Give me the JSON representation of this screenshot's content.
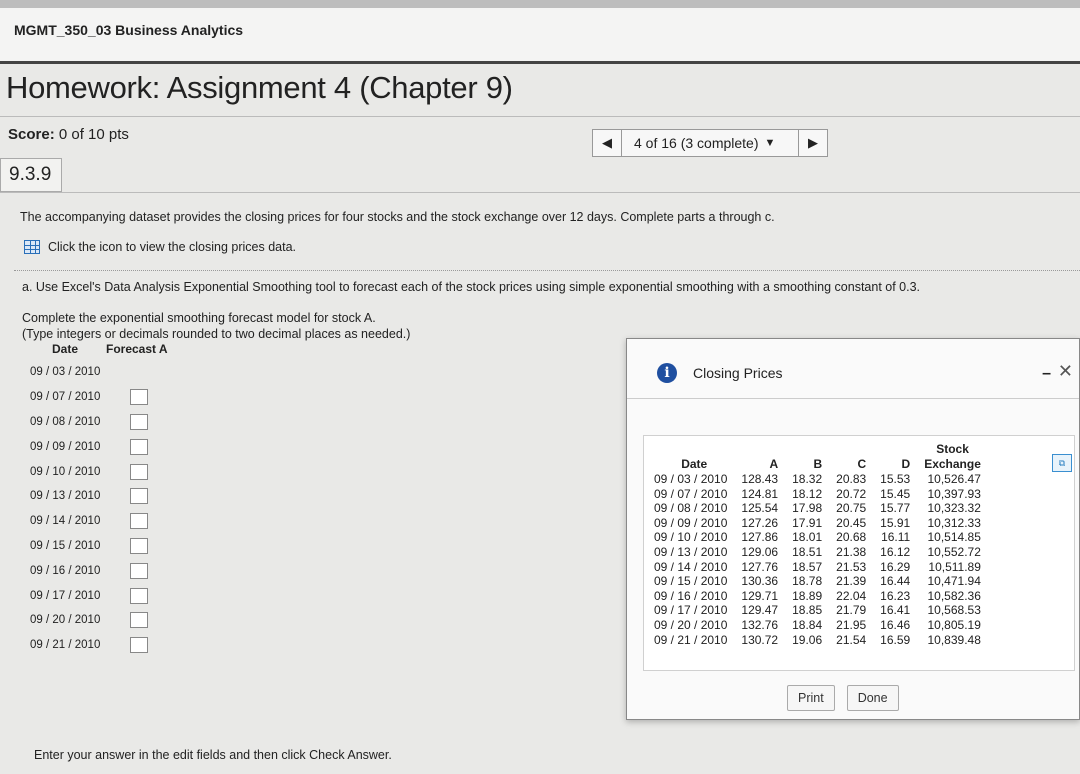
{
  "course": {
    "title": "MGMT_350_03 Business Analytics"
  },
  "assignment": {
    "title": "Homework: Assignment 4 (Chapter 9)"
  },
  "score": {
    "label": "Score:",
    "value": "0 of 10 pts"
  },
  "nav": {
    "prev_icon": "◀",
    "position": "4 of 16 (3 complete)",
    "dropdown_icon": "▼",
    "next_icon": "▶"
  },
  "question": {
    "number": "9.3.9",
    "intro": "The accompanying dataset provides the closing prices for four stocks and the stock exchange over 12 days. Complete parts a through c.",
    "data_link": "Click the icon to view the closing prices data.",
    "part_a": "a. Use Excel's Data Analysis Exponential Smoothing tool to forecast each of the stock prices using simple exponential smoothing with a smoothing constant of 0.3.",
    "instruction1": "Complete the exponential smoothing forecast model for stock A.",
    "instruction2": "(Type integers or decimals rounded to two decimal places as needed.)",
    "table_headers": {
      "date": "Date",
      "forecast": "Forecast A"
    },
    "rows": [
      {
        "date": "09 / 03 / 2010",
        "has_input": false,
        "value": ""
      },
      {
        "date": "09 / 07 / 2010",
        "has_input": true,
        "value": ""
      },
      {
        "date": "09 / 08 / 2010",
        "has_input": true,
        "value": ""
      },
      {
        "date": "09 / 09 / 2010",
        "has_input": true,
        "value": ""
      },
      {
        "date": "09 / 10 / 2010",
        "has_input": true,
        "value": ""
      },
      {
        "date": "09 / 13 / 2010",
        "has_input": true,
        "value": ""
      },
      {
        "date": "09 / 14 / 2010",
        "has_input": true,
        "value": ""
      },
      {
        "date": "09 / 15 / 2010",
        "has_input": true,
        "value": ""
      },
      {
        "date": "09 / 16 / 2010",
        "has_input": true,
        "value": ""
      },
      {
        "date": "09 / 17 / 2010",
        "has_input": true,
        "value": ""
      },
      {
        "date": "09 / 20 / 2010",
        "has_input": true,
        "value": ""
      },
      {
        "date": "09 / 21 / 2010",
        "has_input": true,
        "value": ""
      }
    ],
    "footer": "Enter your answer in the edit fields and then click Check Answer."
  },
  "popup": {
    "title": "Closing Prices",
    "info_icon": "i",
    "minimize": "–",
    "close": "✕",
    "columns": [
      "Date",
      "A",
      "B",
      "C",
      "D",
      "Stock Exchange"
    ],
    "rows": [
      [
        "09 / 03 / 2010",
        "128.43",
        "18.32",
        "20.83",
        "15.53",
        "10,526.47"
      ],
      [
        "09 / 07 / 2010",
        "124.81",
        "18.12",
        "20.72",
        "15.45",
        "10,397.93"
      ],
      [
        "09 / 08 / 2010",
        "125.54",
        "17.98",
        "20.75",
        "15.77",
        "10,323.32"
      ],
      [
        "09 / 09 / 2010",
        "127.26",
        "17.91",
        "20.45",
        "15.91",
        "10,312.33"
      ],
      [
        "09 / 10 / 2010",
        "127.86",
        "18.01",
        "20.68",
        "16.11",
        "10,514.85"
      ],
      [
        "09 / 13 / 2010",
        "129.06",
        "18.51",
        "21.38",
        "16.12",
        "10,552.72"
      ],
      [
        "09 / 14 / 2010",
        "127.76",
        "18.57",
        "21.53",
        "16.29",
        "10,511.89"
      ],
      [
        "09 / 15 / 2010",
        "130.36",
        "18.78",
        "21.39",
        "16.44",
        "10,471.94"
      ],
      [
        "09 / 16 / 2010",
        "129.71",
        "18.89",
        "22.04",
        "16.23",
        "10,582.36"
      ],
      [
        "09 / 17 / 2010",
        "129.47",
        "18.85",
        "21.79",
        "16.41",
        "10,568.53"
      ],
      [
        "09 / 20 / 2010",
        "132.76",
        "18.84",
        "21.95",
        "16.46",
        "10,805.19"
      ],
      [
        "09 / 21 / 2010",
        "130.72",
        "19.06",
        "21.54",
        "16.59",
        "10,839.48"
      ]
    ],
    "print_label": "Print",
    "done_label": "Done"
  }
}
